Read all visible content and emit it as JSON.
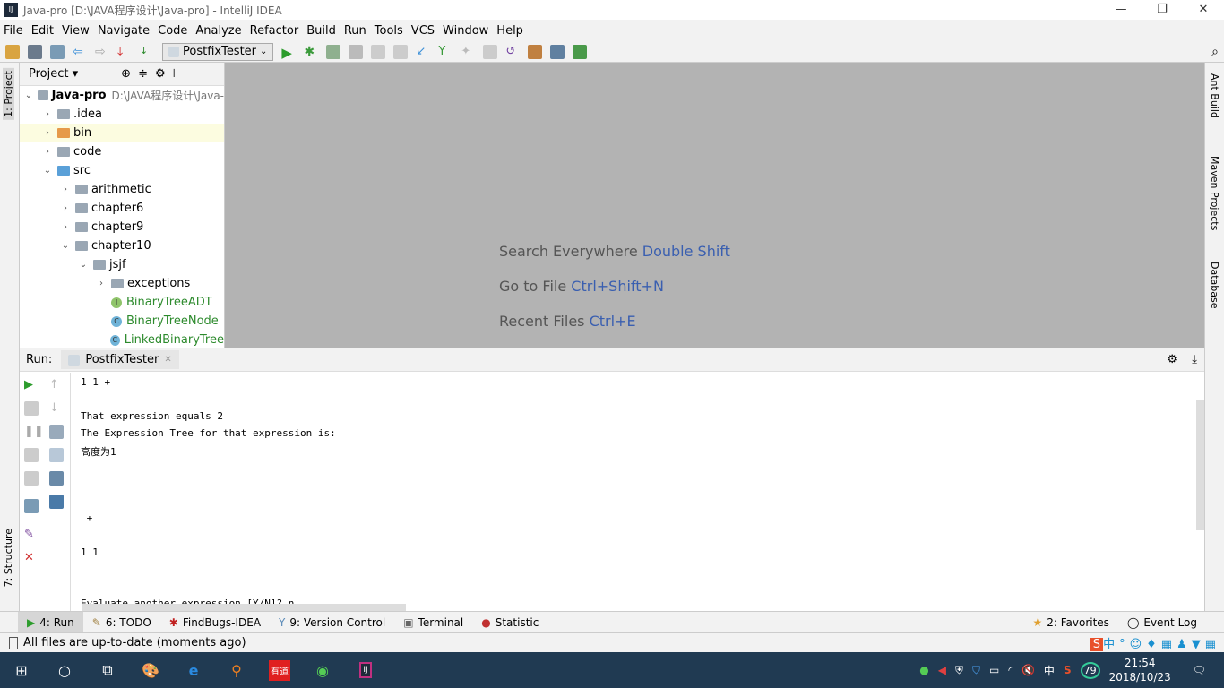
{
  "window": {
    "title": "Java-pro [D:\\JAVA程序设计\\Java-pro] - IntelliJ IDEA",
    "logo": "IJ",
    "minimize": "—",
    "maximize": "❐",
    "close": "✕"
  },
  "menu": [
    "File",
    "Edit",
    "View",
    "Navigate",
    "Code",
    "Analyze",
    "Refactor",
    "Build",
    "Run",
    "Tools",
    "VCS",
    "Window",
    "Help"
  ],
  "toolbar": {
    "run_config": "PostfixTester"
  },
  "left_strip": {
    "project_tab": "1: Project",
    "structure_tab": "7: Structure"
  },
  "right_strip": {
    "ant": "Ant Build",
    "maven": "Maven Projects",
    "database": "Database"
  },
  "project": {
    "title": "Project",
    "tree": [
      {
        "label": "Java-pro",
        "path": "D:\\JAVA程序设计\\Java-",
        "depth": 0,
        "arrow": "v",
        "kind": "module"
      },
      {
        "label": ".idea",
        "depth": 1,
        "arrow": ">",
        "kind": "folder"
      },
      {
        "label": "bin",
        "depth": 1,
        "arrow": ">",
        "kind": "folder-orange",
        "selected": true
      },
      {
        "label": "code",
        "depth": 1,
        "arrow": ">",
        "kind": "folder"
      },
      {
        "label": "src",
        "depth": 1,
        "arrow": "v",
        "kind": "folder-src"
      },
      {
        "label": "arithmetic",
        "depth": 2,
        "arrow": ">",
        "kind": "package"
      },
      {
        "label": "chapter6",
        "depth": 2,
        "arrow": ">",
        "kind": "package"
      },
      {
        "label": "chapter9",
        "depth": 2,
        "arrow": ">",
        "kind": "package"
      },
      {
        "label": "chapter10",
        "depth": 2,
        "arrow": "v",
        "kind": "package"
      },
      {
        "label": "jsjf",
        "depth": 3,
        "arrow": "v",
        "kind": "package"
      },
      {
        "label": "exceptions",
        "depth": 4,
        "arrow": ">",
        "kind": "package"
      },
      {
        "label": "BinaryTreeADT",
        "depth": 4,
        "arrow": "",
        "kind": "interface"
      },
      {
        "label": "BinaryTreeNode",
        "depth": 4,
        "arrow": "",
        "kind": "class"
      },
      {
        "label": "LinkedBinaryTree",
        "depth": 4,
        "arrow": "",
        "kind": "class"
      }
    ]
  },
  "editor": {
    "hints": [
      {
        "text": "Search Everywhere",
        "key": "Double Shift"
      },
      {
        "text": "Go to File",
        "key": "Ctrl+Shift+N"
      },
      {
        "text": "Recent Files",
        "key": "Ctrl+E"
      }
    ]
  },
  "run": {
    "label": "Run:",
    "tab": "PostfixTester",
    "console": [
      "1 1 +",
      "",
      "That expression equals 2",
      "The Expression Tree for that expression is:",
      "高度为1",
      "",
      "",
      "",
      " +",
      "",
      "1 1",
      "",
      "",
      "Evaluate another expression [Y/N]? n"
    ]
  },
  "bottom_tabs": [
    {
      "label": "4: Run",
      "active": true
    },
    {
      "label": "6: TODO"
    },
    {
      "label": "FindBugs-IDEA"
    },
    {
      "label": "9: Version Control"
    },
    {
      "label": "Terminal"
    },
    {
      "label": "Statistic"
    }
  ],
  "bottom_right": {
    "favorites": "2: Favorites",
    "event_log": "Event Log"
  },
  "status": {
    "text": "All files are up-to-date (moments ago)"
  },
  "taskbar": {
    "time": "21:54",
    "date": "2018/10/23",
    "ime": "中",
    "badge": "79",
    "youdao": "有道"
  }
}
